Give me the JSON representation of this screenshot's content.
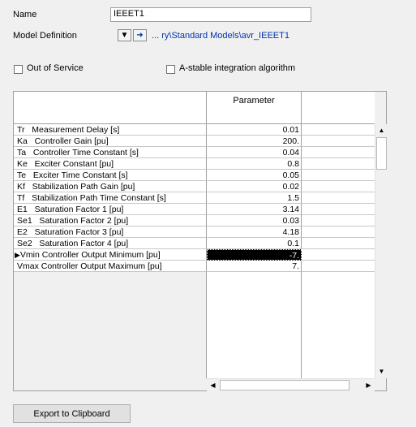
{
  "form": {
    "name_label": "Name",
    "name_value": "IEEET1",
    "model_def_label": "Model Definition",
    "model_def_path": "... ry\\Standard Models\\avr_IEEET1",
    "out_of_service_label": "Out of Service",
    "out_of_service_checked": false,
    "astable_label": "A-stable integration algorithm",
    "astable_checked": false
  },
  "icons": {
    "dropdown": "triangle-down-icon",
    "jump": "arrow-right-icon",
    "row_pointer": "triangle-right-icon"
  },
  "grid": {
    "column_header": "Parameter",
    "selected_row_index": 11,
    "rows": [
      {
        "name": "Tr   Measurement Delay [s]",
        "value": "0.01"
      },
      {
        "name": "Ka   Controller Gain [pu]",
        "value": "200."
      },
      {
        "name": "Ta   Controller Time Constant [s]",
        "value": "0.04"
      },
      {
        "name": "Ke   Exciter Constant [pu]",
        "value": "0.8"
      },
      {
        "name": "Te   Exciter Time Constant [s]",
        "value": "0.05"
      },
      {
        "name": "Kf   Stabilization Path Gain [pu]",
        "value": "0.02"
      },
      {
        "name": "Tf   Stabilization Path Time Constant [s]",
        "value": "1.5"
      },
      {
        "name": "E1   Saturation Factor 1 [pu]",
        "value": "3.14"
      },
      {
        "name": "Se1   Saturation Factor 2 [pu]",
        "value": "0.03"
      },
      {
        "name": "E2   Saturation Factor 3 [pu]",
        "value": "4.18"
      },
      {
        "name": "Se2   Saturation Factor 4 [pu]",
        "value": "0.1"
      },
      {
        "name": "Vmin Controller Output Minimum [pu]",
        "value": "-7."
      },
      {
        "name": "Vmax Controller Output Maximum [pu]",
        "value": "7."
      }
    ]
  },
  "buttons": {
    "export": "Export to Clipboard"
  },
  "colors": {
    "link": "#0033aa",
    "selection_bg": "#000000",
    "selection_fg": "#ffffff"
  }
}
